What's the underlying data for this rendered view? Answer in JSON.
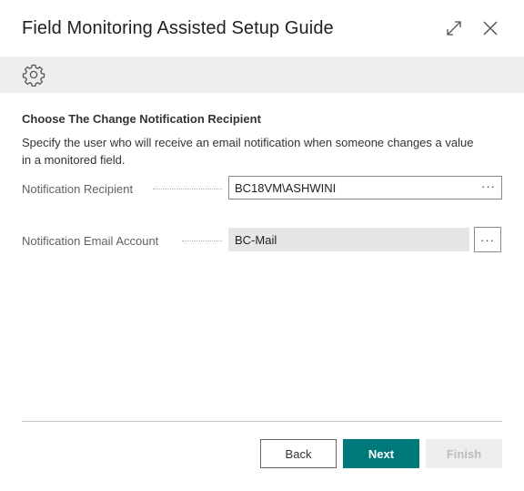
{
  "dialog": {
    "title": "Field Monitoring Assisted Setup Guide",
    "expand_icon": "expand-icon",
    "close_icon": "close-icon"
  },
  "toolbar": {
    "icon": "gear-icon"
  },
  "section": {
    "title": "Choose The Change Notification Recipient",
    "instructions": "Specify the user who will receive an email notification when someone changes a value in a monitored field."
  },
  "fields": {
    "recipient": {
      "label": "Notification Recipient",
      "value": "BC18VM\\ASHWINI",
      "lookup": "···"
    },
    "email_account": {
      "label": "Notification Email Account",
      "value": "BC-Mail",
      "lookup": "···"
    }
  },
  "footer": {
    "back": "Back",
    "next": "Next",
    "finish": "Finish"
  },
  "colors": {
    "primary": "#00797a",
    "toolbar_bg": "#eeeeee"
  }
}
